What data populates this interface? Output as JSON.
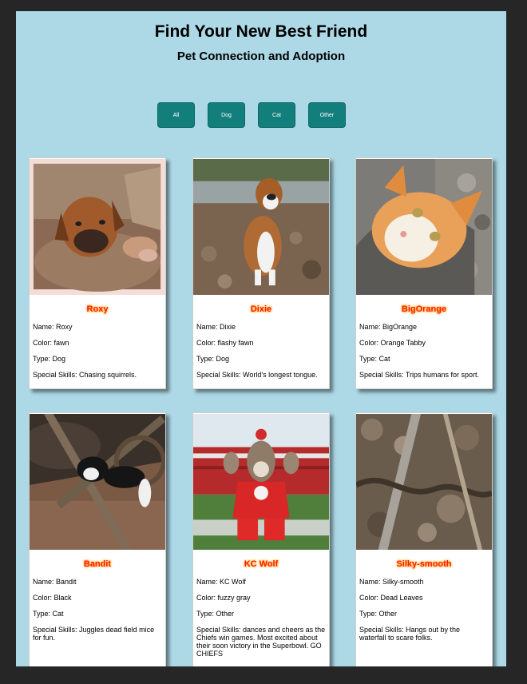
{
  "header": {
    "title": "Find Your New Best Friend",
    "subtitle": "Pet Connection and Adoption"
  },
  "filters": [
    {
      "label": "All"
    },
    {
      "label": "Dog"
    },
    {
      "label": "Cat"
    },
    {
      "label": "Other"
    }
  ],
  "pets": [
    {
      "title": "Roxy",
      "name": "Name: Roxy",
      "color": "Color: fawn",
      "type": "Type: Dog",
      "skills": "Special Skills: Chasing squirrels."
    },
    {
      "title": "Dixie",
      "name": "Name: Dixie",
      "color": "Color: flashy fawn",
      "type": "Type: Dog",
      "skills": "Special Skills: World's longest tongue."
    },
    {
      "title": "BigOrange",
      "name": "Name: BigOrange",
      "color": "Color: Orange Tabby",
      "type": "Type: Cat",
      "skills": "Special Skills: Trips humans for sport."
    },
    {
      "title": "Bandit",
      "name": "Name: Bandit",
      "color": "Color: Black",
      "type": "Type: Cat",
      "skills": "Special Skills: Juggles dead field mice for fun."
    },
    {
      "title": "KC Wolf",
      "name": "Name: KC Wolf",
      "color": "Color: fuzzy gray",
      "type": "Type: Other",
      "skills": "Special Skills: dances and cheers as the Chiefs win games. Most excited about their soon victory in the Superbowl. GO CHIEFS"
    },
    {
      "title": "Silky-smooth",
      "name": "Name: Silky-smooth",
      "color": "Color: Dead Leaves",
      "type": "Type: Other",
      "skills": "Special Skills: Hangs out by the waterfall to scare folks."
    }
  ],
  "colors": {
    "page_background": "#add8e6",
    "button": "#137f7d",
    "pet_title": "#ff1a1a"
  }
}
